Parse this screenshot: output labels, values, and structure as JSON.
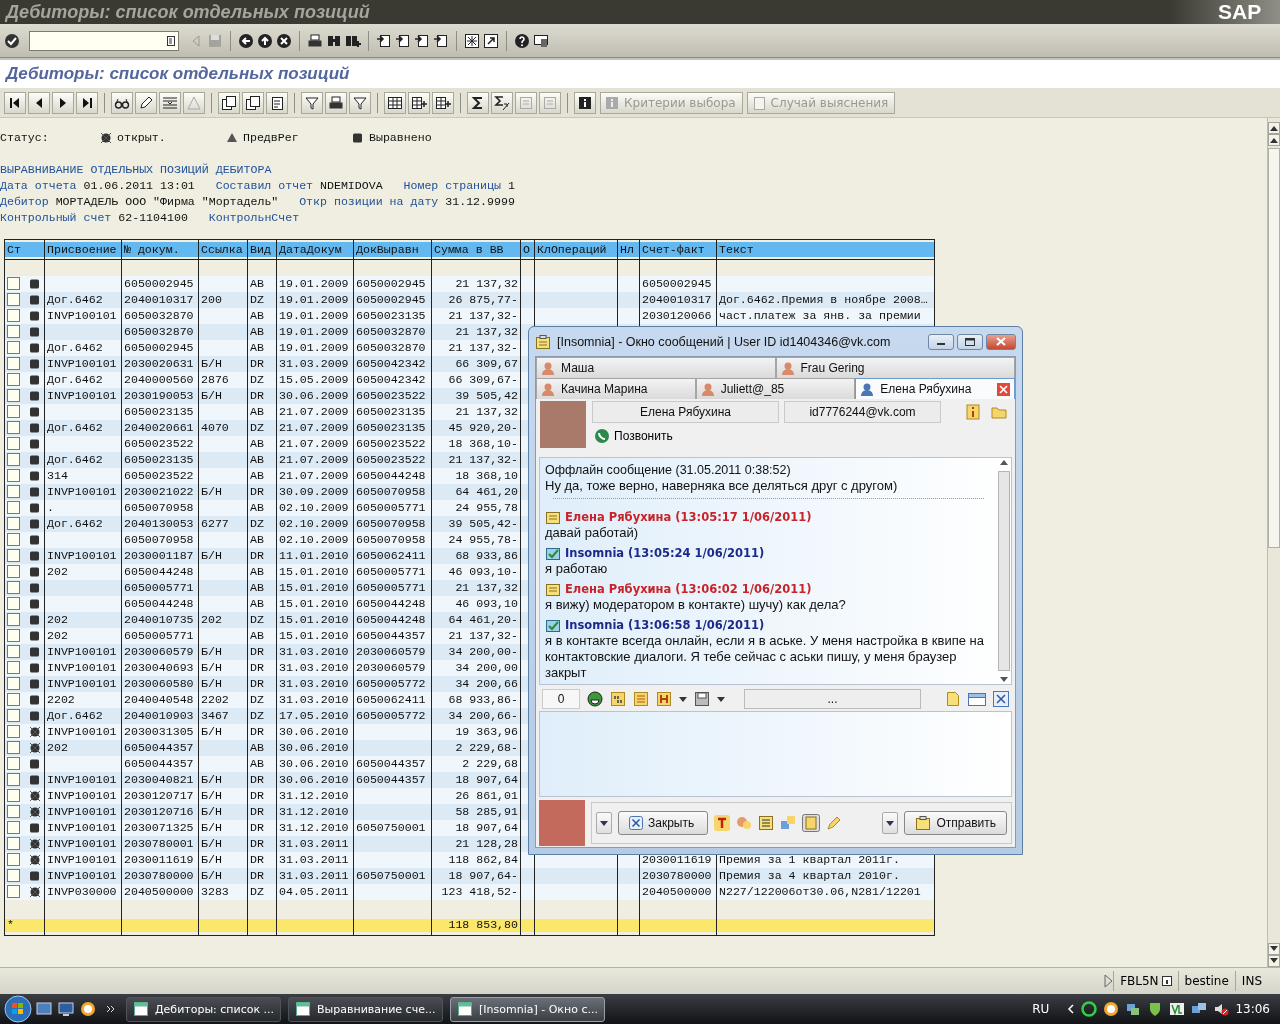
{
  "window_title": "Дебиторы: список отдельных позиций",
  "sap_logo": "SAP",
  "app_title": "Дебиторы: список отдельных позиций",
  "app_toolbar_buttons": [
    {
      "label": "Критерии выбора",
      "disabled": true
    },
    {
      "label": "Случай выяснения",
      "disabled": true
    }
  ],
  "legend": {
    "label": "Статус:",
    "items": [
      {
        "kind": "open",
        "label": "открыт."
      },
      {
        "kind": "parked",
        "label": "ПредвРег"
      },
      {
        "kind": "cleared",
        "label": "Выравнено"
      }
    ]
  },
  "report_header": [
    {
      "segments": [
        {
          "kind": "title",
          "text": "ВЫРАВНИВАНИЕ ОТДЕЛЬНЫХ ПОЗИЦИЙ ДЕБИТОРА"
        }
      ]
    },
    {
      "segments": [
        {
          "kind": "label",
          "text": "Дата отчета"
        },
        {
          "kind": "value",
          "text": "01.06.2011 13:01"
        },
        {
          "kind": "label",
          "text": "Составил отчет"
        },
        {
          "kind": "value",
          "text": "NDEMIDOVA"
        },
        {
          "kind": "label",
          "text": "Номер страницы"
        },
        {
          "kind": "value",
          "text": "1"
        }
      ]
    },
    {
      "segments": [
        {
          "kind": "label",
          "text": "Дебитор"
        },
        {
          "kind": "value",
          "text": "МОРТАДЕЛЬ ООО \"Фирма \"Мортадель\""
        },
        {
          "kind": "label",
          "text": "Откр позиции на дату"
        },
        {
          "kind": "value",
          "text": "31.12.9999"
        }
      ]
    },
    {
      "segments": [
        {
          "kind": "label",
          "text": "Контрольный счет"
        },
        {
          "kind": "value",
          "text": "62-1104100"
        },
        {
          "kind": "label",
          "text": "КонтрольнСчет"
        }
      ]
    }
  ],
  "table": {
    "columns": [
      "Ст",
      "Присвоение",
      "№ докум.",
      "Ссылка",
      "Вид",
      "ДатаДокум",
      "ДокВыравн",
      "Сумма в ВВ",
      "О",
      "КлОпераций",
      "Нл",
      "Счет-факт",
      "Текст"
    ],
    "rows": [
      {
        "checked": false,
        "kind": "cleared",
        "doc_no": "6050002945",
        "type": "AB",
        "doc_date": "19.01.2009",
        "clearing_doc": "6050002945",
        "amount": "21 137,32",
        "invoice": "6050002945"
      },
      {
        "checked": false,
        "kind": "cleared",
        "assignment": "Дог.6462",
        "doc_no": "2040010317",
        "reference": "200",
        "type": "DZ",
        "doc_date": "19.01.2009",
        "clearing_doc": "6050002945",
        "amount": "26 875,77-",
        "invoice": "2040010317",
        "text": "Дог.6462.Премия в ноябре 2008…"
      },
      {
        "checked": false,
        "kind": "cleared",
        "assignment": "INVP100101",
        "doc_no": "6050032870",
        "type": "AB",
        "doc_date": "19.01.2009",
        "clearing_doc": "6050023135",
        "amount": "21 137,32-",
        "invoice": "2030120066",
        "text": "част.платеж за янв. за премии"
      },
      {
        "checked": false,
        "kind": "cleared",
        "doc_no": "6050032870",
        "type": "AB",
        "doc_date": "19.01.2009",
        "clearing_doc": "6050032870",
        "amount": "21 137,32"
      },
      {
        "checked": false,
        "kind": "cleared",
        "assignment": "Дог.6462",
        "doc_no": "6050002945",
        "type": "AB",
        "doc_date": "19.01.2009",
        "clearing_doc": "6050032870",
        "amount": "21 137,32-"
      },
      {
        "checked": false,
        "kind": "cleared",
        "assignment": "INVP100101",
        "doc_no": "2030020631",
        "reference": "Б/Н",
        "type": "DR",
        "doc_date": "31.03.2009",
        "clearing_doc": "6050042342",
        "amount": "66 309,67"
      },
      {
        "checked": false,
        "kind": "cleared",
        "assignment": "Дог.6462",
        "doc_no": "2040000560",
        "reference": "2876",
        "type": "DZ",
        "doc_date": "15.05.2009",
        "clearing_doc": "6050042342",
        "amount": "66 309,67-"
      },
      {
        "checked": false,
        "kind": "cleared",
        "assignment": "INVP100101",
        "doc_no": "2030190053",
        "reference": "Б/Н",
        "type": "DR",
        "doc_date": "30.06.2009",
        "clearing_doc": "6050023522",
        "amount": "39 505,42"
      },
      {
        "checked": false,
        "kind": "cleared",
        "doc_no": "6050023135",
        "type": "AB",
        "doc_date": "21.07.2009",
        "clearing_doc": "6050023135",
        "amount": "21 137,32"
      },
      {
        "checked": false,
        "kind": "cleared",
        "assignment": "Дог.6462",
        "doc_no": "2040020661",
        "reference": "4070",
        "type": "DZ",
        "doc_date": "21.07.2009",
        "clearing_doc": "6050023135",
        "amount": "45 920,20-"
      },
      {
        "checked": false,
        "kind": "cleared",
        "doc_no": "6050023522",
        "type": "AB",
        "doc_date": "21.07.2009",
        "clearing_doc": "6050023522",
        "amount": "18 368,10-"
      },
      {
        "checked": false,
        "kind": "cleared",
        "assignment": "Дог.6462",
        "doc_no": "6050023135",
        "type": "AB",
        "doc_date": "21.07.2009",
        "clearing_doc": "6050023522",
        "amount": "21 137,32-"
      },
      {
        "checked": false,
        "kind": "cleared",
        "assignment": "314",
        "doc_no": "6050023522",
        "type": "AB",
        "doc_date": "21.07.2009",
        "clearing_doc": "6050044248",
        "amount": "18 368,10"
      },
      {
        "checked": false,
        "kind": "cleared",
        "assignment": "INVP100101",
        "doc_no": "2030021022",
        "reference": "Б/Н",
        "type": "DR",
        "doc_date": "30.09.2009",
        "clearing_doc": "6050070958",
        "amount": "64 461,20"
      },
      {
        "checked": false,
        "kind": "cleared",
        "assignment": ".",
        "doc_no": "6050070958",
        "type": "AB",
        "doc_date": "02.10.2009",
        "clearing_doc": "6050005771",
        "amount": "24 955,78"
      },
      {
        "checked": false,
        "kind": "cleared",
        "assignment": "Дог.6462",
        "doc_no": "2040130053",
        "reference": "6277",
        "type": "DZ",
        "doc_date": "02.10.2009",
        "clearing_doc": "6050070958",
        "amount": "39 505,42-"
      },
      {
        "checked": false,
        "kind": "cleared",
        "doc_no": "6050070958",
        "type": "AB",
        "doc_date": "02.10.2009",
        "clearing_doc": "6050070958",
        "amount": "24 955,78-"
      },
      {
        "checked": false,
        "kind": "cleared",
        "assignment": "INVP100101",
        "doc_no": "2030001187",
        "reference": "Б/Н",
        "type": "DR",
        "doc_date": "11.01.2010",
        "clearing_doc": "6050062411",
        "amount": "68 933,86"
      },
      {
        "checked": false,
        "kind": "cleared",
        "assignment": "202",
        "doc_no": "6050044248",
        "type": "AB",
        "doc_date": "15.01.2010",
        "clearing_doc": "6050005771",
        "amount": "46 093,10-"
      },
      {
        "checked": false,
        "kind": "cleared",
        "doc_no": "6050005771",
        "type": "AB",
        "doc_date": "15.01.2010",
        "clearing_doc": "6050005771",
        "amount": "21 137,32"
      },
      {
        "checked": false,
        "kind": "cleared",
        "doc_no": "6050044248",
        "type": "AB",
        "doc_date": "15.01.2010",
        "clearing_doc": "6050044248",
        "amount": "46 093,10"
      },
      {
        "checked": false,
        "kind": "cleared",
        "assignment": "202",
        "doc_no": "2040010735",
        "reference": "202",
        "type": "DZ",
        "doc_date": "15.01.2010",
        "clearing_doc": "6050044248",
        "amount": "64 461,20-"
      },
      {
        "checked": false,
        "kind": "cleared",
        "assignment": "202",
        "doc_no": "6050005771",
        "type": "AB",
        "doc_date": "15.01.2010",
        "clearing_doc": "6050044357",
        "amount": "21 137,32-"
      },
      {
        "checked": false,
        "kind": "cleared",
        "assignment": "INVP100101",
        "doc_no": "2030060579",
        "reference": "Б/Н",
        "type": "DR",
        "doc_date": "31.03.2010",
        "clearing_doc": "2030060579",
        "amount": "34 200,00-"
      },
      {
        "checked": false,
        "kind": "cleared",
        "assignment": "INVP100101",
        "doc_no": "2030040693",
        "reference": "Б/Н",
        "type": "DR",
        "doc_date": "31.03.2010",
        "clearing_doc": "2030060579",
        "amount": "34 200,00"
      },
      {
        "checked": false,
        "kind": "cleared",
        "assignment": "INVP100101",
        "doc_no": "2030060580",
        "reference": "Б/Н",
        "type": "DR",
        "doc_date": "31.03.2010",
        "clearing_doc": "6050005772",
        "amount": "34 200,66"
      },
      {
        "checked": false,
        "kind": "cleared",
        "assignment": "2202",
        "doc_no": "2040040548",
        "reference": "2202",
        "type": "DZ",
        "doc_date": "31.03.2010",
        "clearing_doc": "6050062411",
        "amount": "68 933,86-"
      },
      {
        "checked": false,
        "kind": "cleared",
        "assignment": "Дог.6462",
        "doc_no": "2040010903",
        "reference": "3467",
        "type": "DZ",
        "doc_date": "17.05.2010",
        "clearing_doc": "6050005772",
        "amount": "34 200,66-"
      },
      {
        "checked": false,
        "kind": "open",
        "assignment": "INVP100101",
        "doc_no": "2030031305",
        "reference": "Б/Н",
        "type": "DR",
        "doc_date": "30.06.2010",
        "amount": "19 363,96"
      },
      {
        "checked": false,
        "kind": "open",
        "assignment": "202",
        "doc_no": "6050044357",
        "type": "AB",
        "doc_date": "30.06.2010",
        "amount": "2 229,68-"
      },
      {
        "checked": false,
        "kind": "cleared",
        "doc_no": "6050044357",
        "type": "AB",
        "doc_date": "30.06.2010",
        "clearing_doc": "6050044357",
        "amount": "2 229,68"
      },
      {
        "checked": false,
        "kind": "cleared",
        "assignment": "INVP100101",
        "doc_no": "2030040821",
        "reference": "Б/Н",
        "type": "DR",
        "doc_date": "30.06.2010",
        "clearing_doc": "6050044357",
        "amount": "18 907,64"
      },
      {
        "checked": false,
        "kind": "open",
        "assignment": "INVP100101",
        "doc_no": "2030120717",
        "reference": "Б/Н",
        "type": "DR",
        "doc_date": "31.12.2010",
        "amount": "26 861,01"
      },
      {
        "checked": false,
        "kind": "open",
        "assignment": "INVP100101",
        "doc_no": "2030120716",
        "reference": "Б/Н",
        "type": "DR",
        "doc_date": "31.12.2010",
        "amount": "58 285,91"
      },
      {
        "checked": false,
        "kind": "cleared",
        "assignment": "INVP100101",
        "doc_no": "2030071325",
        "reference": "Б/Н",
        "type": "DR",
        "doc_date": "31.12.2010",
        "clearing_doc": "6050750001",
        "amount": "18 907,64"
      },
      {
        "checked": false,
        "kind": "open",
        "assignment": "INVP100101",
        "doc_no": "2030780001",
        "reference": "Б/Н",
        "type": "DR",
        "doc_date": "31.03.2011",
        "amount": "21 128,28"
      },
      {
        "checked": false,
        "kind": "open",
        "assignment": "INVP100101",
        "doc_no": "2030011619",
        "reference": "Б/Н",
        "type": "DR",
        "doc_date": "31.03.2011",
        "amount": "118 862,84",
        "invoice": "2030011619",
        "text": "Премия за 1 квартал 2011г."
      },
      {
        "checked": false,
        "kind": "cleared",
        "assignment": "INVP100101",
        "doc_no": "2030780000",
        "reference": "Б/Н",
        "type": "DR",
        "doc_date": "31.03.2011",
        "clearing_doc": "6050750001",
        "amount": "18 907,64-",
        "invoice": "2030780000",
        "text": "Премия за 4 квартал 2010г."
      },
      {
        "checked": false,
        "kind": "open",
        "assignment": "INVP030000",
        "doc_no": "2040500000",
        "reference": "3283",
        "type": "DZ",
        "doc_date": "04.05.2011",
        "amount": "123 418,52-",
        "invoice": "2040500000",
        "text": "N227/122006от30.06,N281/12201"
      }
    ],
    "totals": {
      "marker": "*",
      "amount": "118 853,80"
    }
  },
  "chat": {
    "title": "[Insomnia] - Окно сообщений | User ID id1404346@vk.com",
    "tab_rows": [
      {
        "tabs": [
          {
            "label": "Маша",
            "selected": false
          },
          {
            "label": "Frau Gering",
            "selected": false
          }
        ]
      },
      {
        "tabs": [
          {
            "label": "Качина Марина",
            "selected": false
          },
          {
            "label": "Juliett@_85",
            "selected": false
          },
          {
            "label": "Елена Рябухина",
            "selected": true
          }
        ]
      }
    ],
    "contact_name": "Елена Рябухина",
    "contact_id": "id7776244@vk.com",
    "call": "Позвонить",
    "messages": [
      {
        "kind": "offline",
        "header": "Оффлайн сообщение (31.05.2011 0:38:52)",
        "text": "Ну да, тоже верно, наверняка все деляться друг с другом)"
      },
      {
        "kind": "incoming",
        "header": "Елена Рябухина (13:05:17 1/06/2011)",
        "text": "давай работай)"
      },
      {
        "kind": "outgoing",
        "header": "Insomnia (13:05:24 1/06/2011)",
        "text": "я работаю"
      },
      {
        "kind": "incoming",
        "header": "Елена Рябухина (13:06:02 1/06/2011)",
        "text": "я вижу) модератором в контакте) шучу) как дела?"
      },
      {
        "kind": "outgoing",
        "header": "Insomnia (13:06:58 1/06/2011)",
        "text": "я в контакте всегда онлайн, если я в аське. У меня настройка в квипе на контактовские диалоги. Я тебе сейчас с аськи пишу, у меня браузер закрыт"
      }
    ],
    "char_count": "0",
    "status_text": "...",
    "close_button": "Закрыть",
    "send_button": "Отправить"
  },
  "status_bar": {
    "transaction": "FBL5N",
    "server": "bestine",
    "mode": "INS"
  },
  "taskbar": {
    "tasks": [
      {
        "label": "Дебиторы: список ...",
        "selected": false
      },
      {
        "label": "Выравнивание сче...",
        "selected": false
      },
      {
        "label": "[Insomnia] - Окно с...",
        "selected": true
      }
    ],
    "language": "RU",
    "clock": "13:06"
  }
}
